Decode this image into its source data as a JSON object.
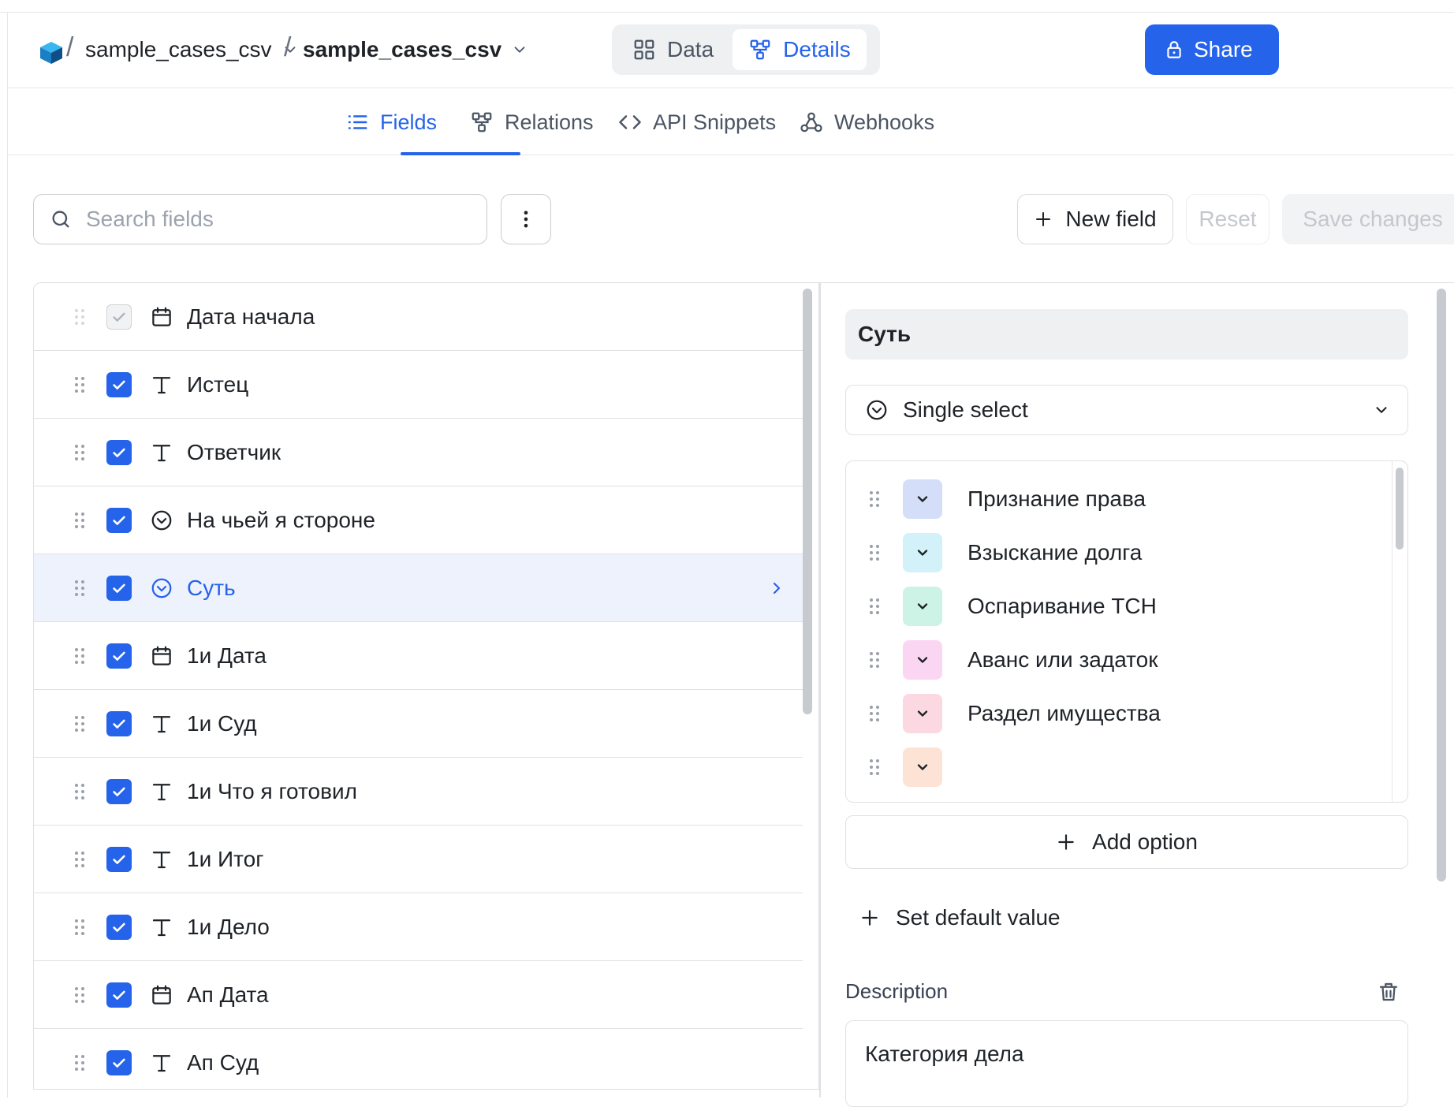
{
  "breadcrumb": {
    "workspace": "sample_cases_csv",
    "table": "sample_cases_csv"
  },
  "view_switch": {
    "data_label": "Data",
    "details_label": "Details",
    "active": "Details"
  },
  "share_label": "Share",
  "tabs": {
    "fields": "Fields",
    "relations": "Relations",
    "api_snippets": "API Snippets",
    "webhooks": "Webhooks",
    "active": "Fields"
  },
  "toolbar": {
    "search_placeholder": "Search fields",
    "new_field": "New field",
    "reset": "Reset",
    "save_changes": "Save changes"
  },
  "fields": [
    {
      "name": "Дата начала",
      "type": "date",
      "checked": true,
      "disabled": true
    },
    {
      "name": "Истец",
      "type": "text",
      "checked": true
    },
    {
      "name": "Ответчик",
      "type": "text",
      "checked": true
    },
    {
      "name": "На чьей я стороне",
      "type": "single-select",
      "checked": true
    },
    {
      "name": "Суть",
      "type": "single-select",
      "checked": true,
      "selected": true
    },
    {
      "name": "1и Дата",
      "type": "date",
      "checked": true
    },
    {
      "name": "1и Суд",
      "type": "text",
      "checked": true
    },
    {
      "name": "1и Что я готовил",
      "type": "text",
      "checked": true
    },
    {
      "name": "1и Итог",
      "type": "text",
      "checked": true
    },
    {
      "name": "1и Дело",
      "type": "text",
      "checked": true
    },
    {
      "name": "Ап Дата",
      "type": "date",
      "checked": true
    },
    {
      "name": "Ап Суд",
      "type": "text",
      "checked": true
    }
  ],
  "detail": {
    "field_name": "Суть",
    "field_type": "Single select",
    "options": [
      {
        "label": "Признание права",
        "color": "#d5def8"
      },
      {
        "label": "Взыскание долга",
        "color": "#d2f1f8"
      },
      {
        "label": "Оспаривание ТСН",
        "color": "#cdf3e6"
      },
      {
        "label": "Аванс или задаток",
        "color": "#fbd6f3"
      },
      {
        "label": "Раздел имущества",
        "color": "#fcd8e2"
      },
      {
        "label": "",
        "color": "#fde3d6"
      }
    ],
    "add_option": "Add option",
    "set_default": "Set default value",
    "description_label": "Description",
    "description_value": "Категория дела"
  },
  "colors": {
    "accent": "#2563eb",
    "selected_row_bg": "#eef2fc"
  }
}
